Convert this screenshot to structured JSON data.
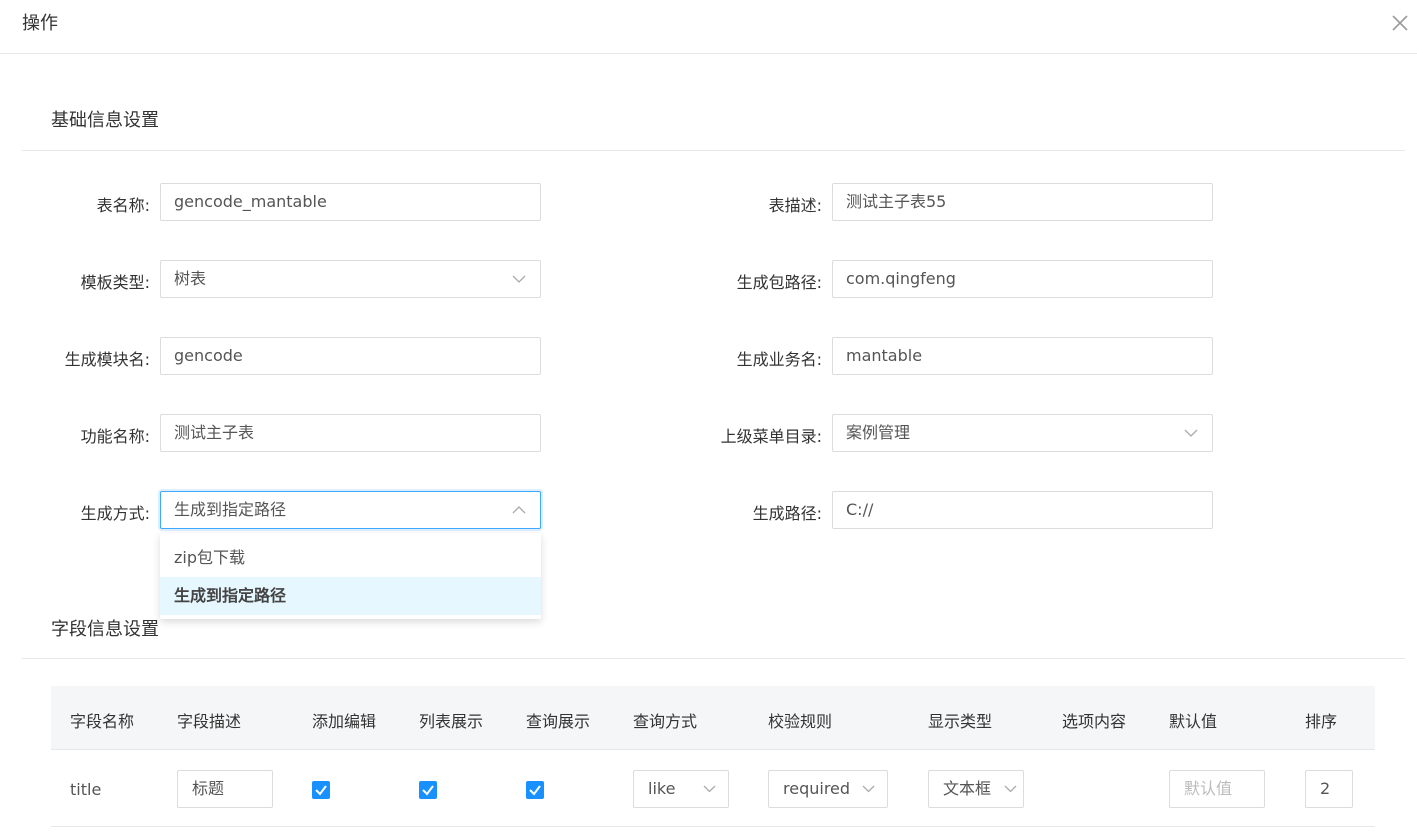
{
  "dialog": {
    "title": "操作"
  },
  "basic_section": {
    "title": "基础信息设置"
  },
  "form": {
    "table_name": {
      "label": "表名称:",
      "value": "gencode_mantable"
    },
    "table_desc": {
      "label": "表描述:",
      "value": "测试主子表55"
    },
    "template_type": {
      "label": "模板类型:",
      "value": "树表"
    },
    "package_path": {
      "label": "生成包路径:",
      "value": "com.qingfeng"
    },
    "module_name": {
      "label": "生成模块名:",
      "value": "gencode"
    },
    "business_name": {
      "label": "生成业务名:",
      "value": "mantable"
    },
    "function_name": {
      "label": "功能名称:",
      "value": "测试主子表"
    },
    "parent_menu": {
      "label": "上级菜单目录:",
      "value": "案例管理"
    },
    "gen_method": {
      "label": "生成方式:",
      "value": "生成到指定路径",
      "options": [
        "zip包下载",
        "生成到指定路径"
      ],
      "selected_index": 1
    },
    "gen_path": {
      "label": "生成路径:",
      "value": "C://"
    }
  },
  "field_section": {
    "title": "字段信息设置"
  },
  "table": {
    "headers": [
      "字段名称",
      "字段描述",
      "添加编辑",
      "列表展示",
      "查询展示",
      "查询方式",
      "校验规则",
      "显示类型",
      "选项内容",
      "默认值",
      "排序"
    ],
    "rows": [
      {
        "field_name": "title",
        "field_desc": "标题",
        "add_edit": true,
        "list_show": true,
        "query_show": true,
        "query_way": "like",
        "validate": "required",
        "show_type": "文本框",
        "option_content": "",
        "default_placeholder": "默认值",
        "sort": "2"
      }
    ]
  },
  "colors": {
    "accent": "#1890ff",
    "focus_border": "#40a9ff",
    "selected_bg": "#e6f7ff"
  }
}
